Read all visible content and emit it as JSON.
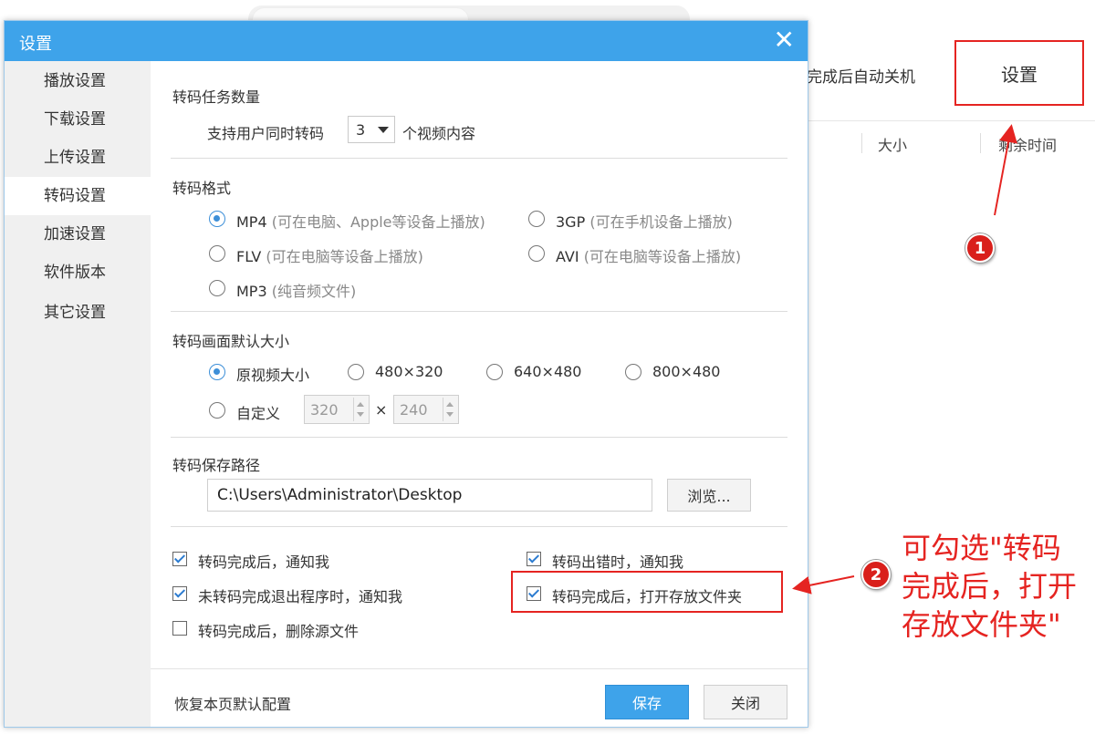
{
  "background": {
    "toolbar_item": "完成后自动关机",
    "settings_button": "设置",
    "columns": [
      "大小",
      "剩余时间"
    ]
  },
  "dialog": {
    "title": "设置",
    "close_glyph": "✕",
    "nav": [
      "播放设置",
      "下载设置",
      "上传设置",
      "转码设置",
      "加速设置",
      "软件版本",
      "其它设置"
    ],
    "active_nav": "转码设置",
    "task_count": {
      "section_title": "转码任务数量",
      "prefix": "支持用户同时转码",
      "value": "3",
      "suffix": "个视频内容"
    },
    "format": {
      "section_title": "转码格式",
      "options": [
        {
          "label": "MP4",
          "hint": "(可在电脑、Apple等设备上播放)",
          "selected": true
        },
        {
          "label": "3GP",
          "hint": "(可在手机设备上播放)",
          "selected": false
        },
        {
          "label": "FLV",
          "hint": "(可在电脑等设备上播放)",
          "selected": false
        },
        {
          "label": "AVI",
          "hint": "(可在电脑等设备上播放)",
          "selected": false
        },
        {
          "label": "MP3",
          "hint": "(纯音频文件)",
          "selected": false
        }
      ]
    },
    "size": {
      "section_title": "转码画面默认大小",
      "options": [
        {
          "label": "原视频大小",
          "selected": true
        },
        {
          "label": "480×320",
          "selected": false
        },
        {
          "label": "640×480",
          "selected": false
        },
        {
          "label": "800×480",
          "selected": false
        },
        {
          "label": "自定义",
          "selected": false
        }
      ],
      "custom_width": "320",
      "times": "×",
      "custom_height": "240"
    },
    "path": {
      "section_title": "转码保存路径",
      "value": "C:\\Users\\Administrator\\Desktop",
      "browse": "浏览..."
    },
    "checks": [
      {
        "label": "转码完成后，通知我",
        "checked": true
      },
      {
        "label": "转码出错时，通知我",
        "checked": true
      },
      {
        "label": "未转码完成退出程序时，通知我",
        "checked": true
      },
      {
        "label": "转码完成后，打开存放文件夹",
        "checked": true
      },
      {
        "label": "转码完成后，删除源文件",
        "checked": false
      }
    ],
    "footer": {
      "restore": "恢复本页默认配置",
      "save": "保存",
      "close": "关闭"
    }
  },
  "annotations": {
    "badge1": "1",
    "badge2": "2",
    "note": "可勾选\"转码完成后，打开存放文件夹\"",
    "color": "#e52421"
  }
}
